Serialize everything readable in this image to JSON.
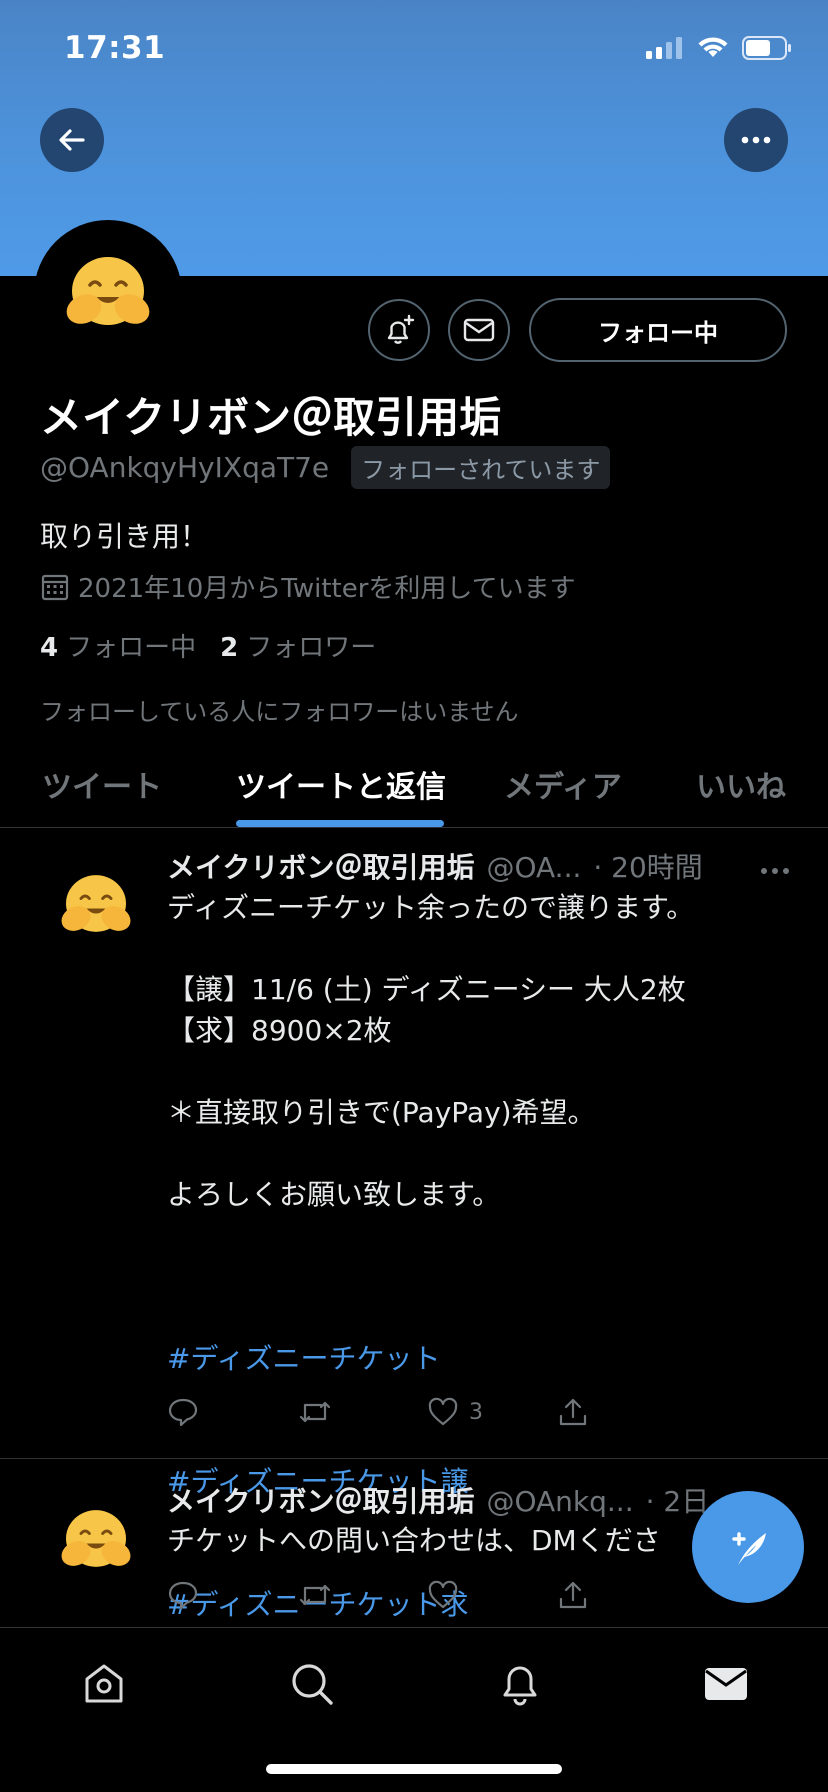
{
  "status_bar": {
    "time": "17:31"
  },
  "profile": {
    "name": "メイクリボン＠取引用垢",
    "handle": "@OAnkqyHyIXqaT7e",
    "follows_you": "フォローされています",
    "bio": "取り引き用！",
    "joined": "2021年10月からTwitterを利用しています",
    "following_count": "4",
    "following_label": "フォロー中",
    "followers_count": "2",
    "followers_label": "フォロワー",
    "no_mutual_followers": "フォローしている人にフォロワーはいません",
    "follow_button_label": "フォロー中"
  },
  "tabs": [
    {
      "label": "ツイート"
    },
    {
      "label": "ツイートと返信"
    },
    {
      "label": "メディア"
    },
    {
      "label": "いいね"
    }
  ],
  "tweets": [
    {
      "name": "メイクリボン＠取引用垢",
      "handle": "@OA...",
      "time": "· 20時間",
      "body": "ディズニーチケット余ったので譲ります。\n\n【譲】11/6 (土) ディズニーシー 大人2枚\n【求】8900×2枚\n\n＊直接取り引きで(PayPay)希望。\n\nよろしくお願い致します。\n",
      "hashtags": [
        "#ディズニーチケット",
        "#ディズニーチケット譲",
        "#ディズニーチケット求"
      ],
      "like_count": "3"
    },
    {
      "name": "メイクリボン＠取引用垢",
      "handle": "@OAnkq...",
      "time": "· 2日",
      "body": "チケットへの問い合わせは、DMくださ"
    }
  ],
  "icons": {
    "back": "arrow-left-icon",
    "more": "more-horizontal-icon",
    "notify": "bell-plus-icon",
    "message": "envelope-icon",
    "calendar": "calendar-icon",
    "reply": "reply-icon",
    "retweet": "retweet-icon",
    "like": "heart-icon",
    "share": "share-icon",
    "compose": "compose-tweet-icon",
    "nav_home": "home-icon",
    "nav_search": "search-icon",
    "nav_notifications": "bell-icon",
    "nav_messages": "mail-icon"
  },
  "colors": {
    "accent": "#4a99e9",
    "banner": "#4d93dc",
    "background": "#000000",
    "muted": "#71767b"
  }
}
